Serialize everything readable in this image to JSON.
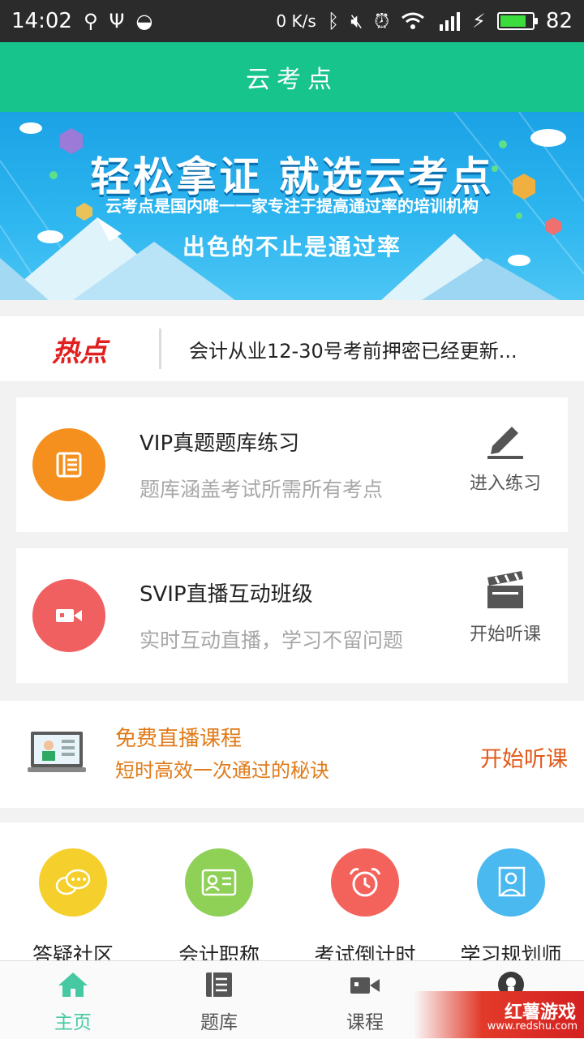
{
  "status_bar": {
    "time": "14:02",
    "net_speed": "0 K/s",
    "battery_level": "82",
    "battery_fraction": 0.82,
    "icons": [
      "usb-icon",
      "share-icon",
      "sync-icon",
      "bluetooth-icon",
      "mute-icon",
      "alarm-icon",
      "wifi-icon",
      "signal-4g-icon",
      "charging-icon",
      "battery-icon"
    ]
  },
  "app_bar": {
    "title": "云考点"
  },
  "banner": {
    "headline": "轻松拿证 就选云考点",
    "subline": "云考点是国内唯一一家专注于提高通过率的培训机构",
    "tagline": "出色的不止是通过率"
  },
  "hot_news": {
    "tag": "热点",
    "text": "会计从业12-30号考前押密已经更新..."
  },
  "cards": [
    {
      "title": "VIP真题题库练习",
      "subtitle": "题库涵盖考试所需所有考点",
      "action": "进入练习",
      "color": "#f5901e",
      "icon": "question-bank-icon",
      "action_icon": "pencil-icon"
    },
    {
      "title": "SVIP直播互动班级",
      "subtitle": "实时互动直播，学习不留问题",
      "action": "开始听课",
      "color": "#f06060",
      "icon": "video-camera-icon",
      "action_icon": "clapperboard-icon"
    }
  ],
  "free_course": {
    "title": "免费直播课程",
    "subtitle": "短时高效一次通过的秘诀",
    "action": "开始听课",
    "icon": "laptop-teacher-icon"
  },
  "grid": [
    {
      "label": "答疑社区",
      "color": "#f5cf2b",
      "icon": "chat-bubbles-icon"
    },
    {
      "label": "会计职称",
      "color": "#8fd057",
      "icon": "id-card-icon"
    },
    {
      "label": "考试倒计时",
      "color": "#f4625c",
      "icon": "alarm-clock-icon"
    },
    {
      "label": "学习规划师",
      "color": "#4ab9f0",
      "icon": "planner-icon"
    }
  ],
  "tabs": [
    {
      "label": "主页",
      "active": true,
      "icon": "home-icon"
    },
    {
      "label": "题库",
      "active": false,
      "icon": "book-icon"
    },
    {
      "label": "课程",
      "active": false,
      "icon": "video-icon"
    },
    {
      "label": "",
      "active": false,
      "icon": "profile-icon"
    }
  ],
  "colors": {
    "primary": "#17c48b",
    "tab_active": "#46c9a3",
    "tab_inactive": "#555555",
    "hot": "#e02020",
    "free_text": "#e07b1a"
  },
  "watermark": {
    "logo": "红薯游戏",
    "url": "www.redshu.com"
  }
}
